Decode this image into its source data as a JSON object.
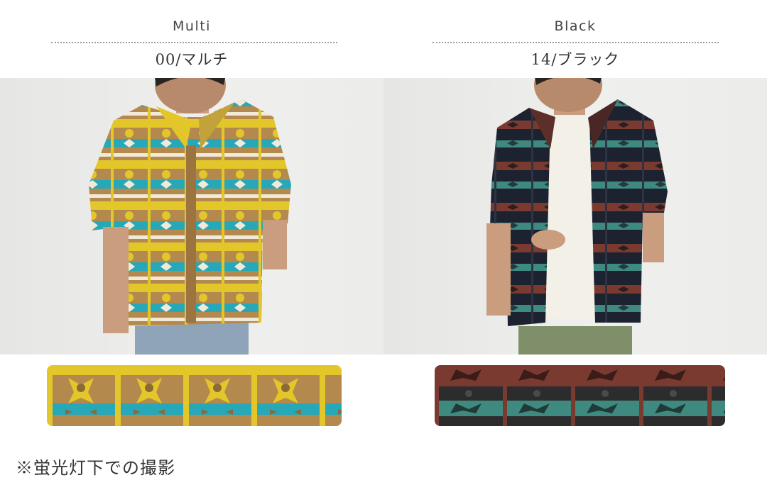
{
  "colors": [
    {
      "name_en": "Multi",
      "name_jp": "00/マルチ",
      "palette": [
        "#b3894e",
        "#e3c72a",
        "#27a8b8",
        "#f2ead8"
      ]
    },
    {
      "name_en": "Black",
      "name_jp": "14/ブラック",
      "palette": [
        "#1c2230",
        "#7a3a30",
        "#3f8a80",
        "#2c2c2c"
      ]
    }
  ],
  "note": "※蛍光灯下での撮影"
}
